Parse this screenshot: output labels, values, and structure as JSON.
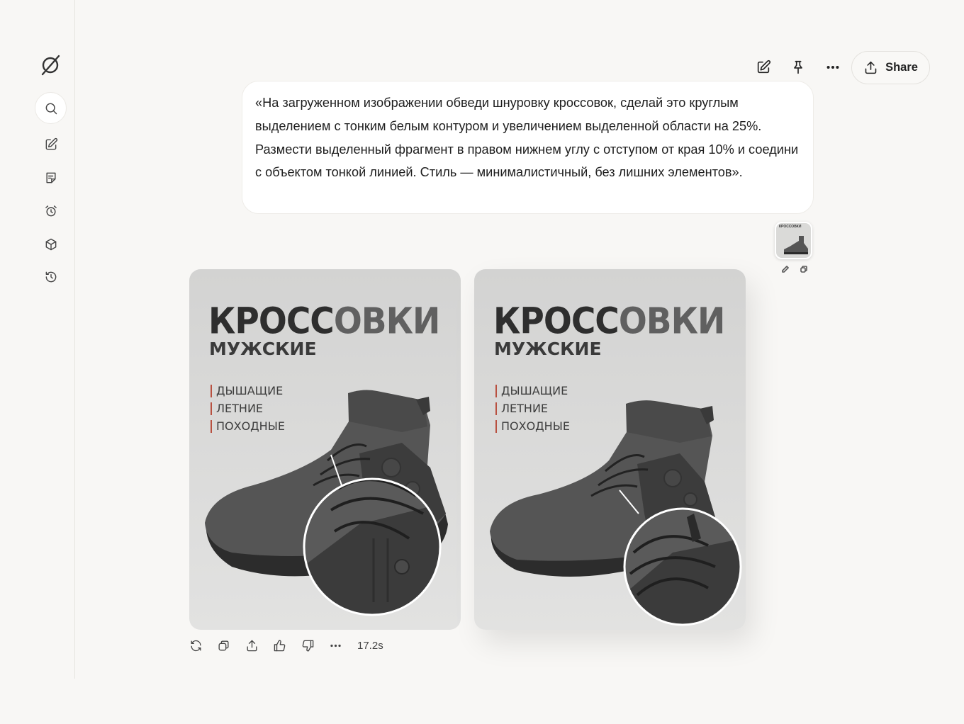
{
  "sidebar": {
    "logo": "grok-logo-icon",
    "items": [
      {
        "name": "search",
        "icon": "search-icon"
      },
      {
        "name": "new-chat",
        "icon": "edit-icon"
      },
      {
        "name": "notes",
        "icon": "notes-icon"
      },
      {
        "name": "tasks",
        "icon": "alarm-icon"
      },
      {
        "name": "projects",
        "icon": "cube-icon"
      },
      {
        "name": "history",
        "icon": "history-icon"
      }
    ]
  },
  "header": {
    "share_label": "Share"
  },
  "message": {
    "text": "«На загруженном изображении обведи шнуровку кроссовок, сделай это круглым выделением с тонким белым контуром и увеличением выделенной области на 25%. Размести выделенный фрагмент в правом нижнем углу с отступом от края 10% и соедини с объектом тонкой линией. Стиль — минималистичный, без лишних элементов».",
    "attachment_caption": "КРОССОВКИ"
  },
  "results": [
    {
      "title_dark": "КРОСС",
      "title_light": "ОВКИ",
      "subtitle": "МУЖСКИЕ",
      "features": [
        "ДЫШАЩИЕ",
        "ЛЕТНИЕ",
        "ПОХОДНЫЕ"
      ]
    },
    {
      "title_dark": "КРОСС",
      "title_light": "ОВКИ",
      "subtitle": "МУЖСКИЕ",
      "features": [
        "ДЫШАЩИЕ",
        "ЛЕТНИЕ",
        "ПОХОДНЫЕ"
      ]
    }
  ],
  "response_actions": {
    "icons": [
      "regenerate-icon",
      "copy-icon",
      "share-icon",
      "thumbs-up-icon",
      "thumbs-down-icon",
      "more-icon"
    ],
    "elapsed": "17.2s"
  },
  "colors": {
    "background": "#f8f7f5",
    "bubble": "#ffffff",
    "feature_accent": "#b85040"
  }
}
